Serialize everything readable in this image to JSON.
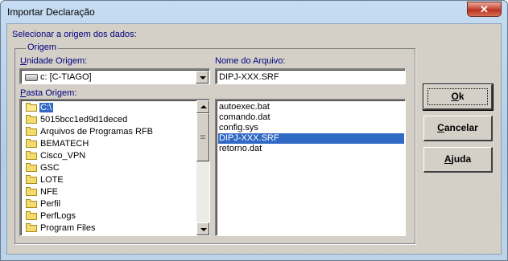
{
  "window": {
    "title": "Importar Declaração",
    "close_label": "✕"
  },
  "dialog": {
    "prompt": "Selecionar a origem dos dados:",
    "group_title": "Origem",
    "unidade_label_hotkey": "U",
    "unidade_label_rest": "nidade Origem:",
    "unidade_value": "c: [C-TIAGO]",
    "arquivo_label": "Nome do Arquivo:",
    "arquivo_value": "DIPJ-XXX.SRF",
    "pasta_label_hotkey": "P",
    "pasta_label_rest": "asta Origem:",
    "folders": [
      {
        "name": "C:\\",
        "selected": true
      },
      {
        "name": "5015bcc1ed9d1deced"
      },
      {
        "name": "Arquivos de Programas RFB"
      },
      {
        "name": "BEMATECH"
      },
      {
        "name": "Cisco_VPN"
      },
      {
        "name": "GSC"
      },
      {
        "name": "LOTE"
      },
      {
        "name": "NFE"
      },
      {
        "name": "Perfil"
      },
      {
        "name": "PerfLogs"
      },
      {
        "name": "Program Files"
      }
    ],
    "files": [
      {
        "name": "autoexec.bat"
      },
      {
        "name": "comando.dat"
      },
      {
        "name": "config.sys"
      },
      {
        "name": "DIPJ-XXX.SRF",
        "selected": true
      },
      {
        "name": "retorno.dat"
      }
    ]
  },
  "buttons": {
    "ok": {
      "hotkey": "O",
      "rest": "k"
    },
    "cancelar": {
      "hotkey": "C",
      "rest": "ancelar"
    },
    "ajuda": {
      "hotkey": "A",
      "rest": "juda"
    }
  },
  "colors": {
    "label_text": "#00007f",
    "selection": "#316ac5",
    "dialog_face": "#d4d0c8"
  },
  "icons": {
    "folder": "folder-icon",
    "drive": "drive-icon",
    "close": "close-icon"
  }
}
